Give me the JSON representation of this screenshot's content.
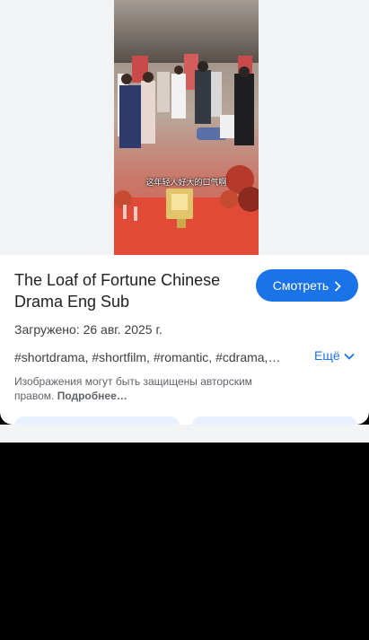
{
  "image": {
    "subtitle_text": "这年轻人好大的口气啊"
  },
  "result": {
    "title": "The Loaf of Fortune Chinese Drama Eng Sub",
    "watch_label": "Смотреть",
    "uploaded": "Загружено: 26 авг. 2025 г.",
    "tags": "#shortdrama, #shortfilm, #romantic, #cdrama, #chinesedrama",
    "more_label": "Ещё",
    "copyright_text": "Изображения могут быть защищены авторским правом.",
    "learn_more": "Подробнее…"
  },
  "colors": {
    "accent": "#1a73e8",
    "text": "#202124",
    "secondary": "#5f6368"
  },
  "icons": [
    "chevron-right-icon",
    "chevron-down-icon"
  ]
}
